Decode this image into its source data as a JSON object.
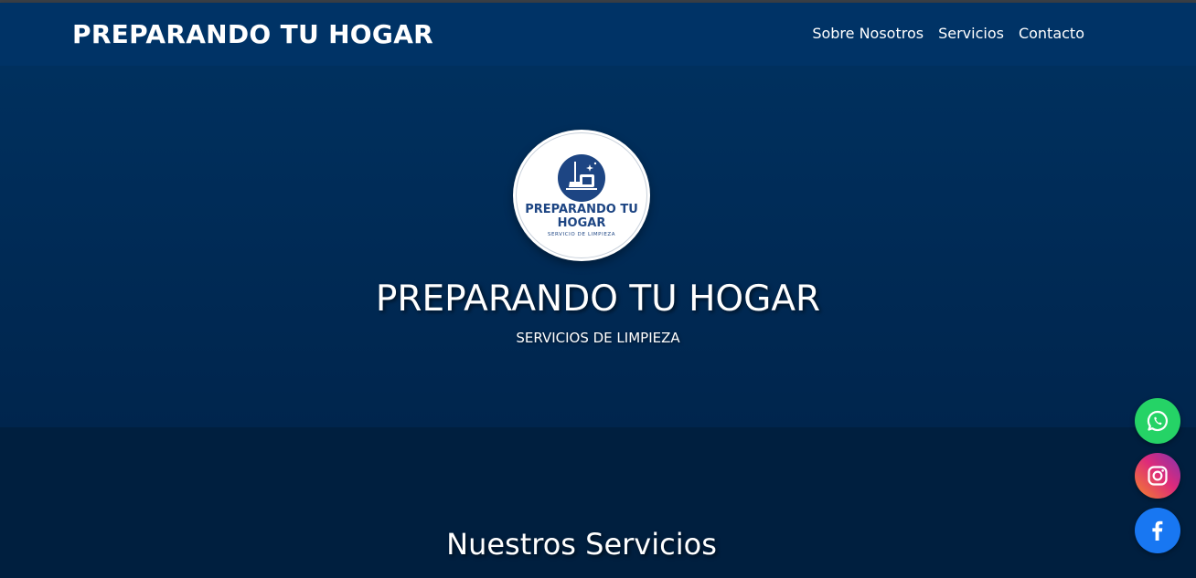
{
  "header": {
    "brand": "PREPARANDO TU HOGAR",
    "nav": [
      {
        "label": "Sobre Nosotros",
        "icon": ""
      },
      {
        "label": "Servicios",
        "icon": ""
      },
      {
        "label": "Contacto",
        "icon": ""
      }
    ]
  },
  "hero": {
    "logo": {
      "line1": "PREPARANDO TU",
      "line2": "HOGAR",
      "line3": "SERVICIO DE LIMPIEZA",
      "icon": "cleaning-bucket-mop-icon"
    },
    "title": "PREPARANDO TU HOGAR",
    "subtitle": "SERVICIOS DE LIMPIEZA"
  },
  "services": {
    "title": "Nuestros Servicios"
  },
  "social": [
    {
      "name": "whatsapp",
      "icon": "whatsapp-icon",
      "color": "#25d366"
    },
    {
      "name": "instagram",
      "icon": "instagram-icon",
      "color": "#e1306c"
    },
    {
      "name": "facebook",
      "icon": "facebook-icon",
      "color": "#1877f2"
    }
  ],
  "colors": {
    "header_bg": "#003366",
    "hero_bg": "#00285a",
    "section_bg": "#001f3f",
    "logo_text": "#1d4583"
  }
}
